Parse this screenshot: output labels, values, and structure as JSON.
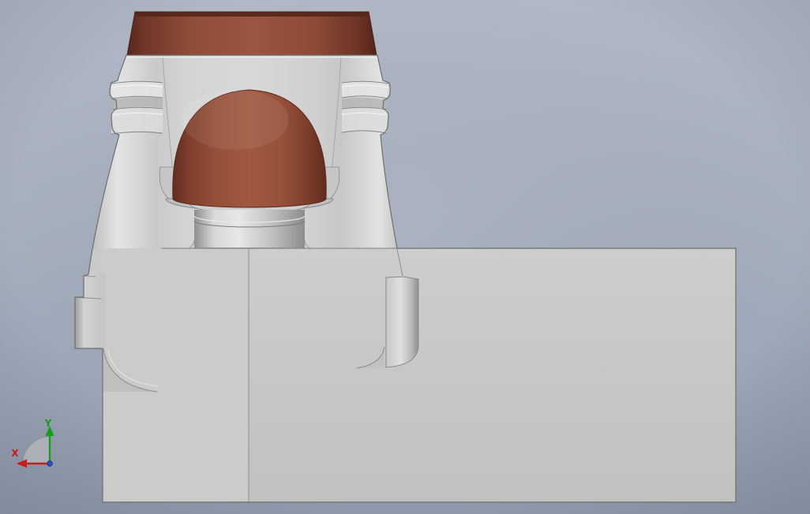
{
  "viewport": {
    "background_top": "#b0b8c6",
    "background_bottom": "#939daf"
  },
  "triad": {
    "x": {
      "label": "X",
      "color": "#cd1a1a"
    },
    "y": {
      "label": "Y",
      "color": "#14a014"
    },
    "origin_color": "#2d4fd4",
    "plane_fan_color": "#b0b4ba"
  },
  "model": {
    "parts": [
      {
        "name": "top-collar-ring",
        "color": "#95513c"
      },
      {
        "name": "dome-insert",
        "color": "#9a5540"
      },
      {
        "name": "sectioned-upper-body",
        "color": "#cccccc"
      },
      {
        "name": "base-block",
        "color": "#cbcbcb"
      }
    ]
  }
}
